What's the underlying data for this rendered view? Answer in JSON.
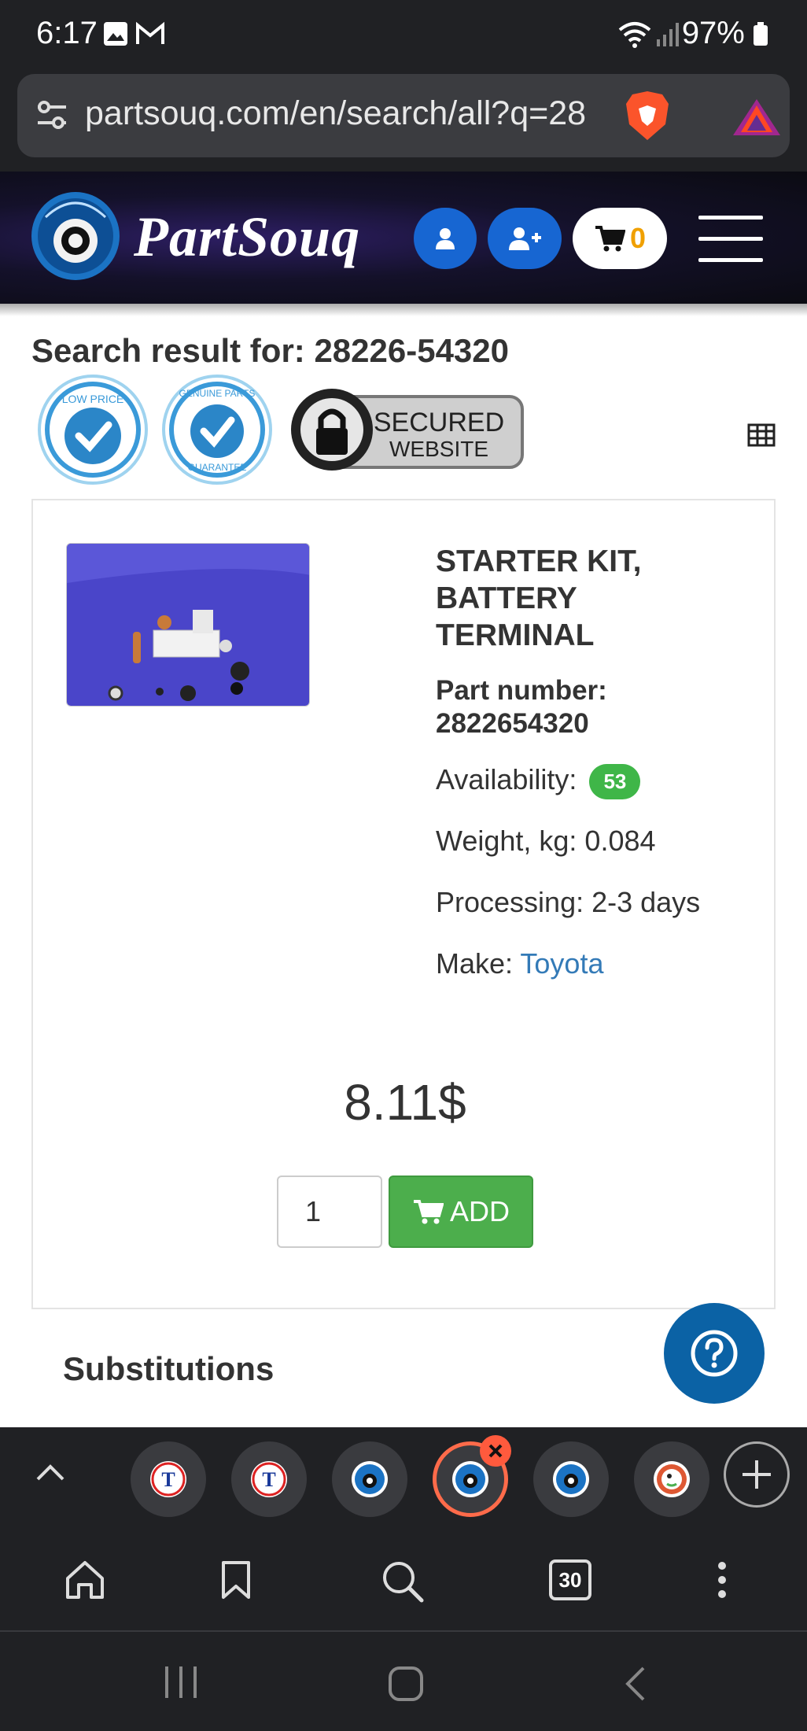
{
  "status": {
    "time": "6:17",
    "battery": "97%"
  },
  "browser": {
    "url": "partsouq.com/en/search/all?q=28"
  },
  "header": {
    "brand": "PartSouq",
    "cart_count": "0"
  },
  "search": {
    "title": "Search result for: 28226-54320"
  },
  "badges": {
    "low_price": "LOW PRICE",
    "genuine": "GENUINE PARTS",
    "guarantee": "GUARANTEE",
    "secured_line1": "SECURED",
    "secured_line2": "WEBSITE"
  },
  "product": {
    "name": "STARTER KIT, BATTERY TERMINAL",
    "part_number_label": "Part number:",
    "part_number": "2822654320",
    "availability_label": "Availability:",
    "availability": "53",
    "weight": "Weight, kg: 0.084",
    "processing": "Processing: 2-3 days",
    "make_label": "Make:",
    "make": "Toyota",
    "price": "8.11$",
    "quantity": "1",
    "add_label": "ADD"
  },
  "sections": {
    "substitutions": "Substitutions"
  },
  "tabs": {
    "count": "30"
  },
  "colors": {
    "accent_blue": "#1766d2",
    "add_green": "#4cae4c",
    "badge_green": "#3fb648",
    "link": "#337ab7",
    "help_blue": "#0b62a5",
    "active_tab": "#ff6b4a"
  }
}
